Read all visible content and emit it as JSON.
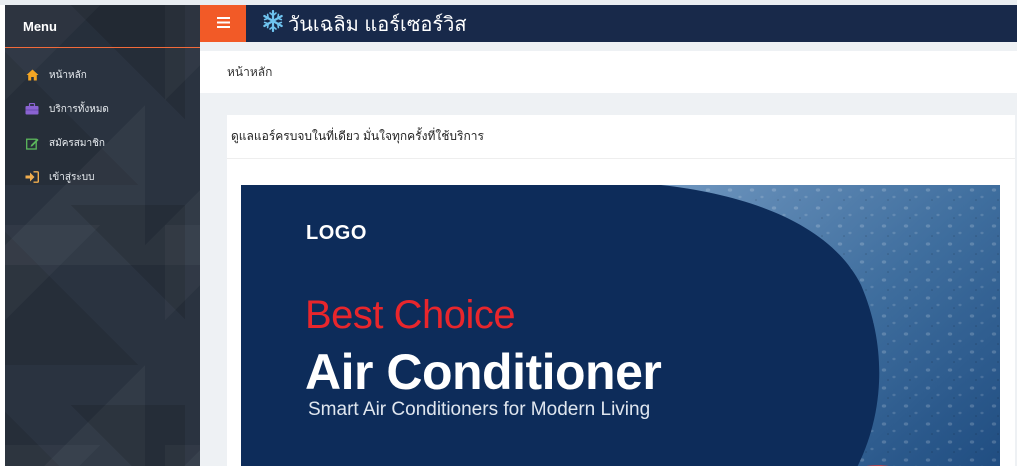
{
  "sidebar": {
    "title": "Menu",
    "items": [
      {
        "label": "หน้าหลัก",
        "icon": "home-icon"
      },
      {
        "label": "บริการทั้งหมด",
        "icon": "briefcase-icon"
      },
      {
        "label": "สมัครสมาชิก",
        "icon": "edit-icon"
      },
      {
        "label": "เข้าสู่ระบบ",
        "icon": "sign-in-icon"
      }
    ]
  },
  "header": {
    "brand_text": "วันเฉลิม แอร์เซอร์วิส",
    "brand_icon": "snowflake-icon",
    "toggle_icon": "hamburger-icon"
  },
  "page": {
    "title": "หน้าหลัก"
  },
  "card": {
    "title": "ดูแลแอร์ครบจบในที่เดียว มั่นใจทุกครั้งที่ใช้บริการ"
  },
  "banner": {
    "logo": "LOGO",
    "line1": "Best Choice",
    "line2": "Air Conditioner",
    "line3": "Smart Air Conditioners for Modern Living"
  },
  "colors": {
    "sidebar_bg": "#2a3340",
    "topbar_bg": "#18294a",
    "accent_orange": "#f25a27",
    "banner_navy": "#0d2c5a",
    "banner_red": "#e8262c",
    "icon_orange": "#f5a623",
    "icon_purple": "#8a63d2",
    "icon_green": "#5cb85c",
    "icon_yellow": "#f0ad4e"
  }
}
